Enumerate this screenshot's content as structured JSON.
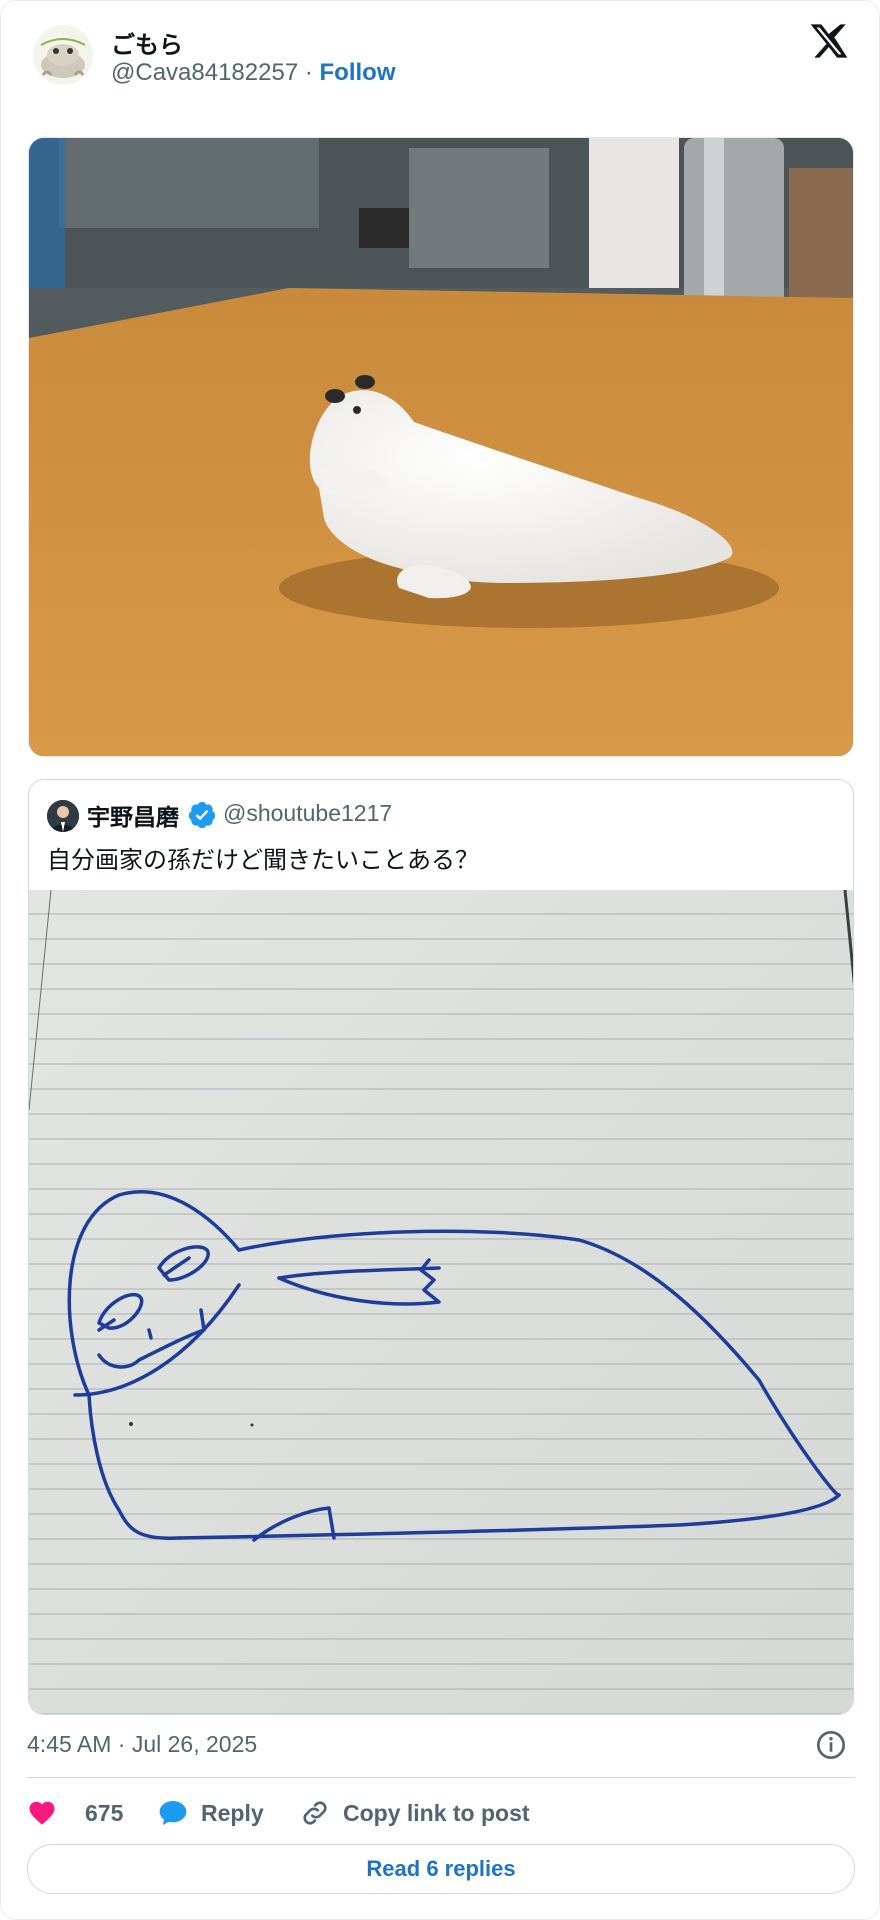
{
  "author": {
    "display_name": "ごもら",
    "handle": "@Cava84182257",
    "separator": " · ",
    "follow_label": "Follow"
  },
  "quoted": {
    "display_name": "宇野昌磨",
    "handle": "@shoutube1217",
    "text": "自分画家の孫だけど聞きたいことある？"
  },
  "timestamp": "4:45 AM · Jul 26, 2025",
  "actions": {
    "like_count": "675",
    "reply_label": "Reply",
    "copy_label": "Copy link to post"
  },
  "read_replies_label": "Read 6 replies",
  "colors": {
    "like": "#f91880",
    "reply": "#1d9bf0",
    "link": "#1d74c4",
    "verified": "#1d9bf0",
    "ink": "#1e3c9a"
  },
  "icons": [
    "x-logo-icon",
    "verified-icon",
    "info-icon",
    "heart-icon",
    "reply-bubble-icon",
    "link-icon"
  ]
}
